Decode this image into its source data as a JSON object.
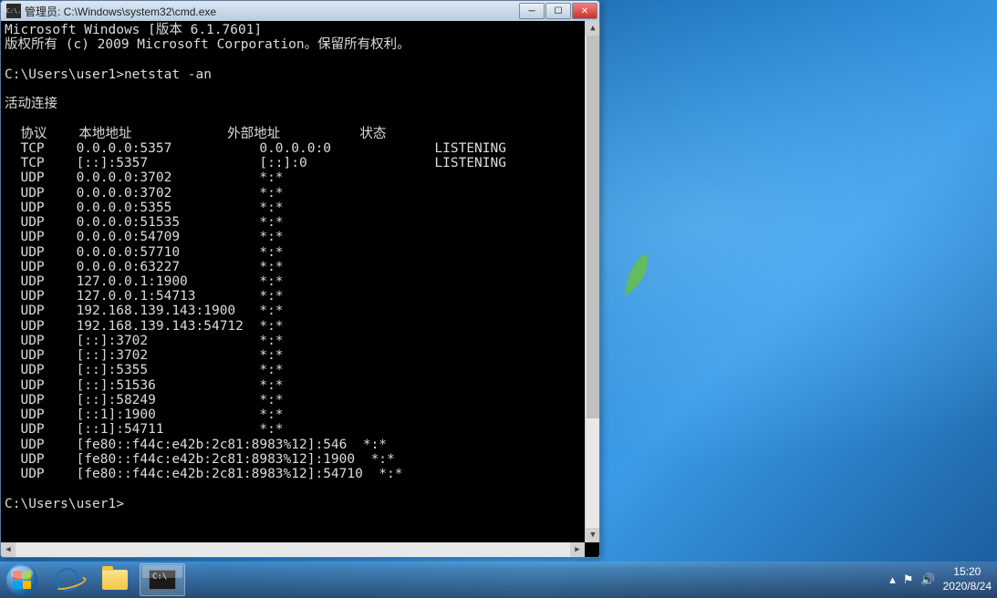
{
  "window": {
    "title": "管理员: C:\\Windows\\system32\\cmd.exe",
    "icon_label": "C:\\."
  },
  "terminal": {
    "banner1": "Microsoft Windows [版本 6.1.7601]",
    "banner2": "版权所有 (c) 2009 Microsoft Corporation。保留所有权利。",
    "prompt1_path": "C:\\Users\\user1>",
    "command": "netstat -an",
    "section_header": "活动连接",
    "columns": {
      "proto": "协议",
      "local": "本地地址",
      "foreign": "外部地址",
      "state": "状态"
    },
    "rows": [
      {
        "proto": "TCP",
        "local": "0.0.0.0:5357",
        "foreign": "0.0.0.0:0",
        "state": "LISTENING"
      },
      {
        "proto": "TCP",
        "local": "[::]:5357",
        "foreign": "[::]:0",
        "state": "LISTENING"
      },
      {
        "proto": "UDP",
        "local": "0.0.0.0:3702",
        "foreign": "*:*",
        "state": ""
      },
      {
        "proto": "UDP",
        "local": "0.0.0.0:3702",
        "foreign": "*:*",
        "state": ""
      },
      {
        "proto": "UDP",
        "local": "0.0.0.0:5355",
        "foreign": "*:*",
        "state": ""
      },
      {
        "proto": "UDP",
        "local": "0.0.0.0:51535",
        "foreign": "*:*",
        "state": ""
      },
      {
        "proto": "UDP",
        "local": "0.0.0.0:54709",
        "foreign": "*:*",
        "state": ""
      },
      {
        "proto": "UDP",
        "local": "0.0.0.0:57710",
        "foreign": "*:*",
        "state": ""
      },
      {
        "proto": "UDP",
        "local": "0.0.0.0:63227",
        "foreign": "*:*",
        "state": ""
      },
      {
        "proto": "UDP",
        "local": "127.0.0.1:1900",
        "foreign": "*:*",
        "state": ""
      },
      {
        "proto": "UDP",
        "local": "127.0.0.1:54713",
        "foreign": "*:*",
        "state": ""
      },
      {
        "proto": "UDP",
        "local": "192.168.139.143:1900",
        "foreign": "*:*",
        "state": ""
      },
      {
        "proto": "UDP",
        "local": "192.168.139.143:54712",
        "foreign": "*:*",
        "state": ""
      },
      {
        "proto": "UDP",
        "local": "[::]:3702",
        "foreign": "*:*",
        "state": ""
      },
      {
        "proto": "UDP",
        "local": "[::]:3702",
        "foreign": "*:*",
        "state": ""
      },
      {
        "proto": "UDP",
        "local": "[::]:5355",
        "foreign": "*:*",
        "state": ""
      },
      {
        "proto": "UDP",
        "local": "[::]:51536",
        "foreign": "*:*",
        "state": ""
      },
      {
        "proto": "UDP",
        "local": "[::]:58249",
        "foreign": "*:*",
        "state": ""
      },
      {
        "proto": "UDP",
        "local": "[::1]:1900",
        "foreign": "*:*",
        "state": ""
      },
      {
        "proto": "UDP",
        "local": "[::1]:54711",
        "foreign": "*:*",
        "state": ""
      },
      {
        "proto": "UDP",
        "local": "[fe80::f44c:e42b:2c81:8983%12]:546",
        "foreign": "*:*",
        "state": ""
      },
      {
        "proto": "UDP",
        "local": "[fe80::f44c:e42b:2c81:8983%12]:1900",
        "foreign": "*:*",
        "state": ""
      },
      {
        "proto": "UDP",
        "local": "[fe80::f44c:e42b:2c81:8983%12]:54710",
        "foreign": "*:*",
        "state": ""
      }
    ],
    "prompt2_path": "C:\\Users\\user1>"
  },
  "taskbar": {
    "time": "15:20",
    "date": "2020/8/24"
  }
}
